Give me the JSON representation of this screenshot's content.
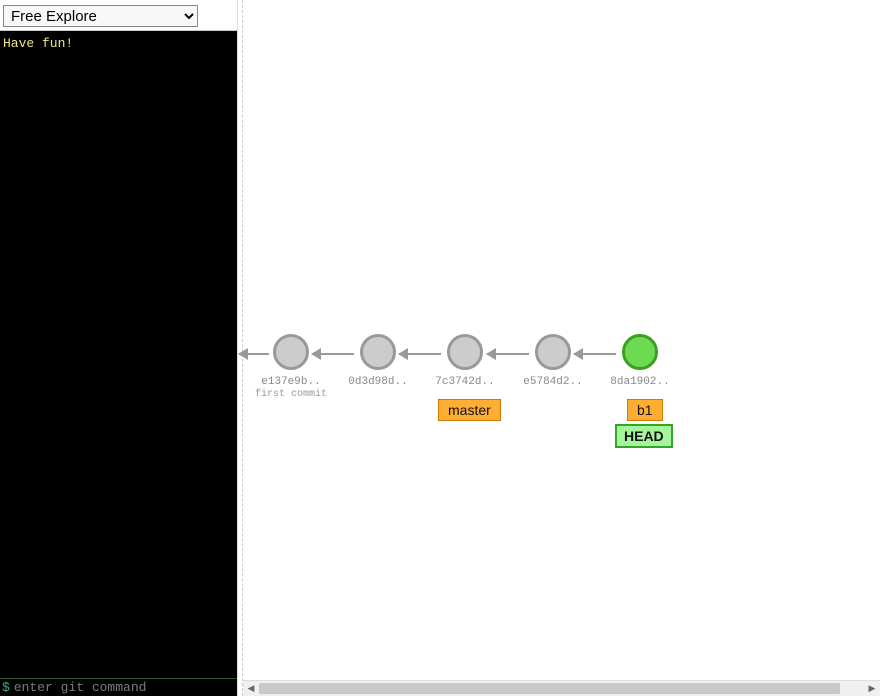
{
  "dropdown": {
    "selected": "Free Explore"
  },
  "terminal": {
    "line1": "Have fun!"
  },
  "prompt": {
    "symbol": "$",
    "placeholder": "enter git command"
  },
  "commits": {
    "c0": {
      "hash": "e137e9b..",
      "msg": "first commit"
    },
    "c1": {
      "hash": "0d3d98d.."
    },
    "c2": {
      "hash": "7c3742d.."
    },
    "c3": {
      "hash": "e5784d2.."
    },
    "c4": {
      "hash": "8da1902.."
    }
  },
  "branches": {
    "master": "master",
    "b1": "b1"
  },
  "head": {
    "label": "HEAD"
  }
}
